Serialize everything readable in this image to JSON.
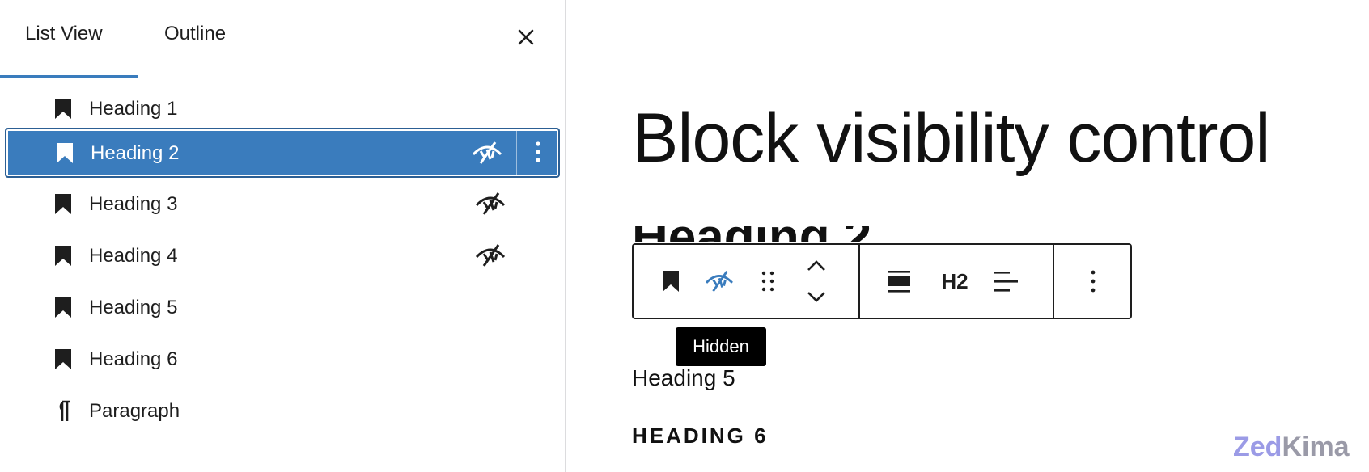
{
  "sidebar": {
    "tabs": [
      {
        "label": "List View"
      },
      {
        "label": "Outline"
      }
    ],
    "items": [
      {
        "label": "Heading 1",
        "icon": "bookmark-icon"
      },
      {
        "label": "Heading 2",
        "icon": "bookmark-icon"
      },
      {
        "label": "Heading 3",
        "icon": "bookmark-icon"
      },
      {
        "label": "Heading 4",
        "icon": "bookmark-icon"
      },
      {
        "label": "Heading 5",
        "icon": "bookmark-icon"
      },
      {
        "label": "Heading 6",
        "icon": "bookmark-icon"
      },
      {
        "label": "Paragraph",
        "icon": "pilcrow-icon"
      }
    ]
  },
  "editor": {
    "title": "Block visibility control",
    "hidden_heading": "Heading 2",
    "toolbar": {
      "heading_level": "H2",
      "tooltip": "Hidden"
    },
    "heading5": "Heading 5",
    "heading6": "HEADING 6"
  },
  "brand": {
    "part1": "Zed",
    "part2": "Kima"
  },
  "colors": {
    "accent": "#3a7cbd",
    "text": "#1e1e1e",
    "tooltip_bg": "#000000",
    "brand_part1": "#9b9be6",
    "brand_part2": "#9a9aa8"
  }
}
